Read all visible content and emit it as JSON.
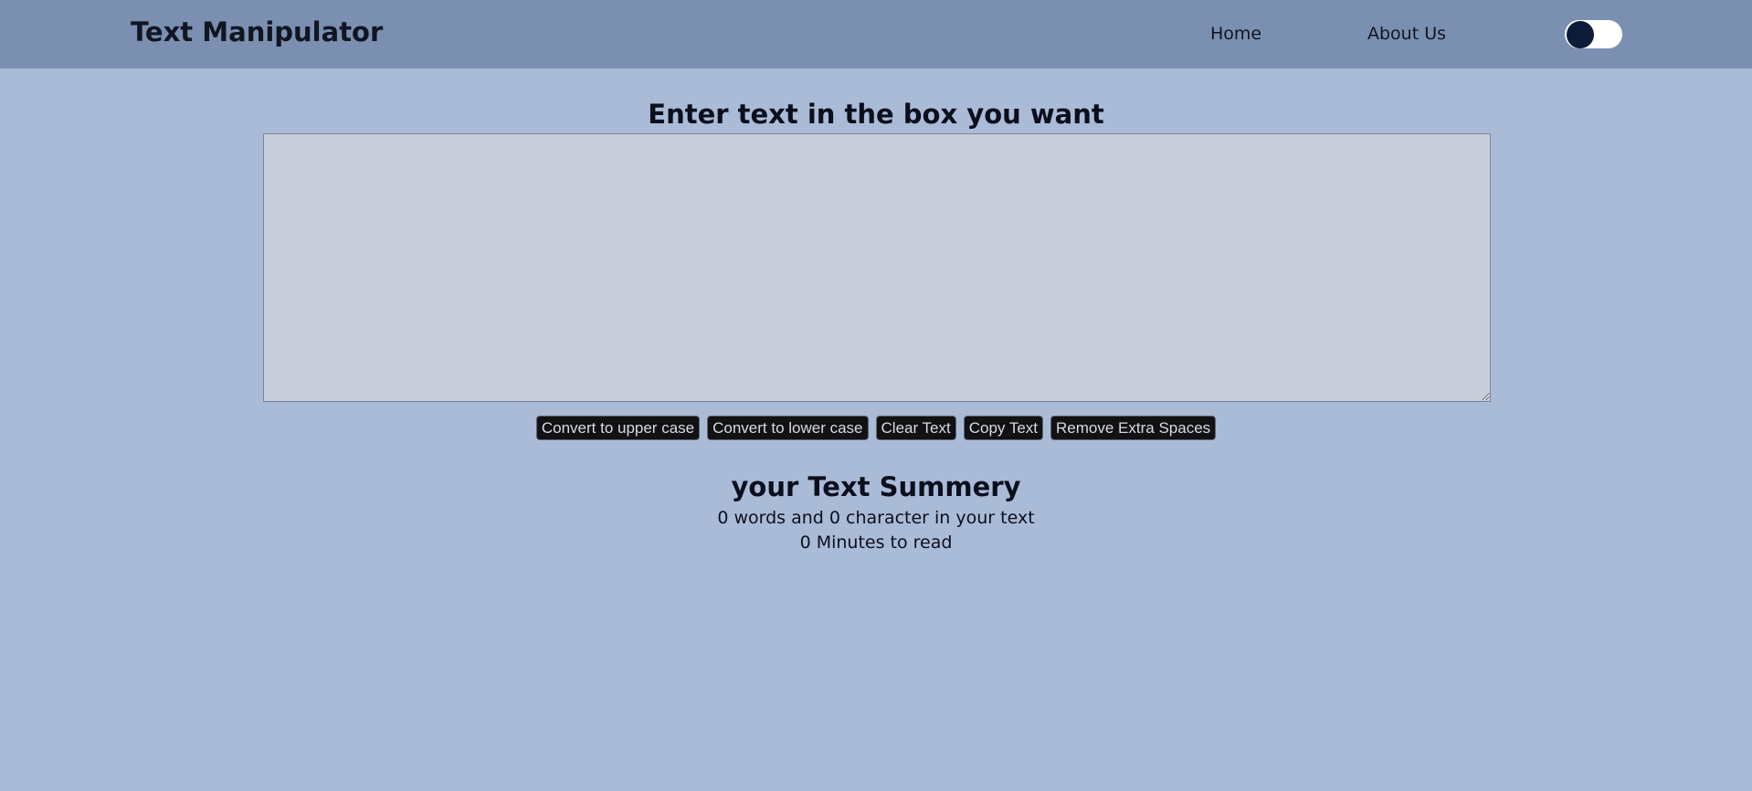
{
  "navbar": {
    "brand": "Text Manipulator",
    "links": [
      "Home",
      "About Us"
    ],
    "dark_mode_toggle": "off"
  },
  "main": {
    "heading": "Enter text in the box you want",
    "textarea_value": "",
    "buttons": [
      "Convert to upper case",
      "Convert to lower case",
      "Clear Text",
      "Copy Text",
      "Remove Extra Spaces"
    ]
  },
  "summary": {
    "title": "your Text Summery",
    "counts": "0 words and 0 character in your text",
    "read_time": "0 Minutes to read"
  },
  "colors": {
    "page_background": "#aabbd8",
    "navbar_background": "#7b90b0",
    "textarea_background": "#c8ced9",
    "button_background": "#121212",
    "toggle_knob": "#0d1b3a"
  }
}
